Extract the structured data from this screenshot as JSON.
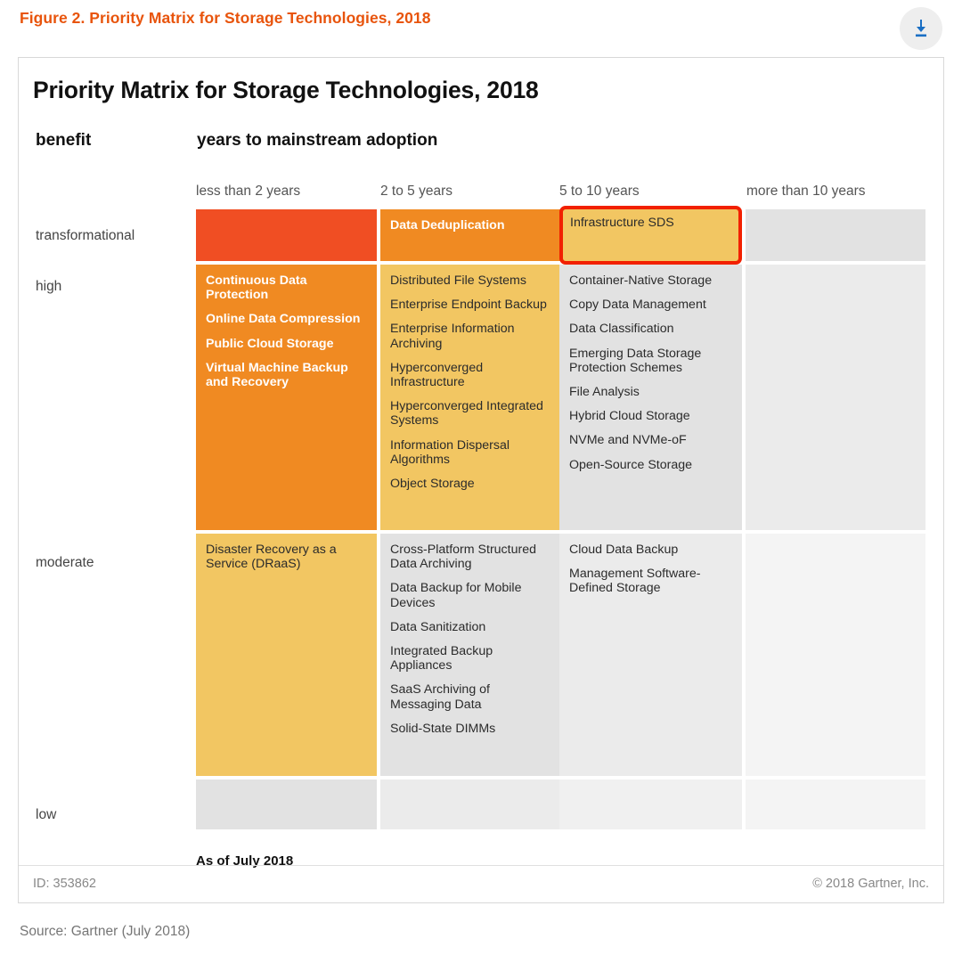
{
  "header": {
    "figure_title": "Figure 2. Priority Matrix for Storage Technologies, 2018",
    "download_icon": "download-icon",
    "accent_color": "#e8540c",
    "icon_color": "#1a6fc4"
  },
  "chart_data": {
    "type": "table",
    "title": "Priority Matrix for Storage Technologies, 2018",
    "ylabel": "benefit",
    "xlabel": "years to mainstream adoption",
    "categories": [
      "less than 2 years",
      "2 to 5 years",
      "5 to 10 years",
      "more than 10 years"
    ],
    "rows": [
      "transformational",
      "high",
      "moderate",
      "low"
    ],
    "legend": [],
    "grid": false,
    "as_of": "As of July 2018",
    "cells": [
      {
        "row": "transformational",
        "values": [
          {
            "column": "less than 2 years",
            "color": "#f04e23",
            "text_style": "white-bold",
            "items": []
          },
          {
            "column": "2 to 5 years",
            "color": "#f08a22",
            "text_style": "white-bold",
            "items": [
              "Data Deduplication"
            ]
          },
          {
            "column": "5 to 10 years",
            "color": "#f2c662",
            "text_style": "dark",
            "highlight": true,
            "highlight_color": "#f22000",
            "items": [
              "Infrastructure SDS"
            ]
          },
          {
            "column": "more than 10 years",
            "color": "#e2e2e2",
            "text_style": "dark",
            "items": []
          }
        ]
      },
      {
        "row": "high",
        "values": [
          {
            "column": "less than 2 years",
            "color": "#f08a22",
            "text_style": "white-bold",
            "items": [
              "Continuous Data Protection",
              "Online Data Compression",
              "Public Cloud Storage",
              "Virtual Machine Backup and Recovery"
            ]
          },
          {
            "column": "2 to 5 years",
            "color": "#f2c662",
            "text_style": "dark",
            "items": [
              "Distributed File Systems",
              "Enterprise Endpoint Backup",
              "Enterprise Information Archiving",
              "Hyperconverged Infrastructure",
              "Hyperconverged Integrated Systems",
              "Information Dispersal Algorithms",
              "Object Storage"
            ]
          },
          {
            "column": "5 to 10 years",
            "color": "#e2e2e2",
            "text_style": "dark",
            "items": [
              "Container-Native Storage",
              "Copy Data Management",
              "Data Classification",
              "Emerging Data Storage Protection Schemes",
              "File Analysis",
              "Hybrid Cloud Storage",
              "NVMe and NVMe-oF",
              "Open-Source Storage"
            ]
          },
          {
            "column": "more than 10 years",
            "color": "#ebebeb",
            "text_style": "dark",
            "items": []
          }
        ]
      },
      {
        "row": "moderate",
        "values": [
          {
            "column": "less than 2 years",
            "color": "#f2c662",
            "text_style": "dark",
            "items": [
              "Disaster Recovery as a Service (DRaaS)"
            ]
          },
          {
            "column": "2 to 5 years",
            "color": "#e2e2e2",
            "text_style": "dark",
            "items": [
              "Cross-Platform Structured Data Archiving",
              "Data Backup for Mobile Devices",
              "Data Sanitization",
              "Integrated Backup Appliances",
              "SaaS Archiving of Messaging Data",
              "Solid-State DIMMs"
            ]
          },
          {
            "column": "5 to 10 years",
            "color": "#ebebeb",
            "text_style": "dark",
            "items": [
              "Cloud Data Backup",
              "Management Software-Defined Storage"
            ]
          },
          {
            "column": "more than 10 years",
            "color": "#f4f4f4",
            "text_style": "dark",
            "items": []
          }
        ]
      },
      {
        "row": "low",
        "values": [
          {
            "column": "less than 2 years",
            "color": "#e2e2e2",
            "text_style": "dark",
            "items": []
          },
          {
            "column": "2 to 5 years",
            "color": "#ebebeb",
            "text_style": "dark",
            "items": []
          },
          {
            "column": "5 to 10 years",
            "color": "#f0f0f0",
            "text_style": "dark",
            "items": []
          },
          {
            "column": "more than 10 years",
            "color": "#f4f4f4",
            "text_style": "dark",
            "items": []
          }
        ]
      }
    ]
  },
  "footer": {
    "id_label": "ID: 353862",
    "copyright": "© 2018 Gartner, Inc."
  },
  "source": "Source: Gartner (July 2018)"
}
